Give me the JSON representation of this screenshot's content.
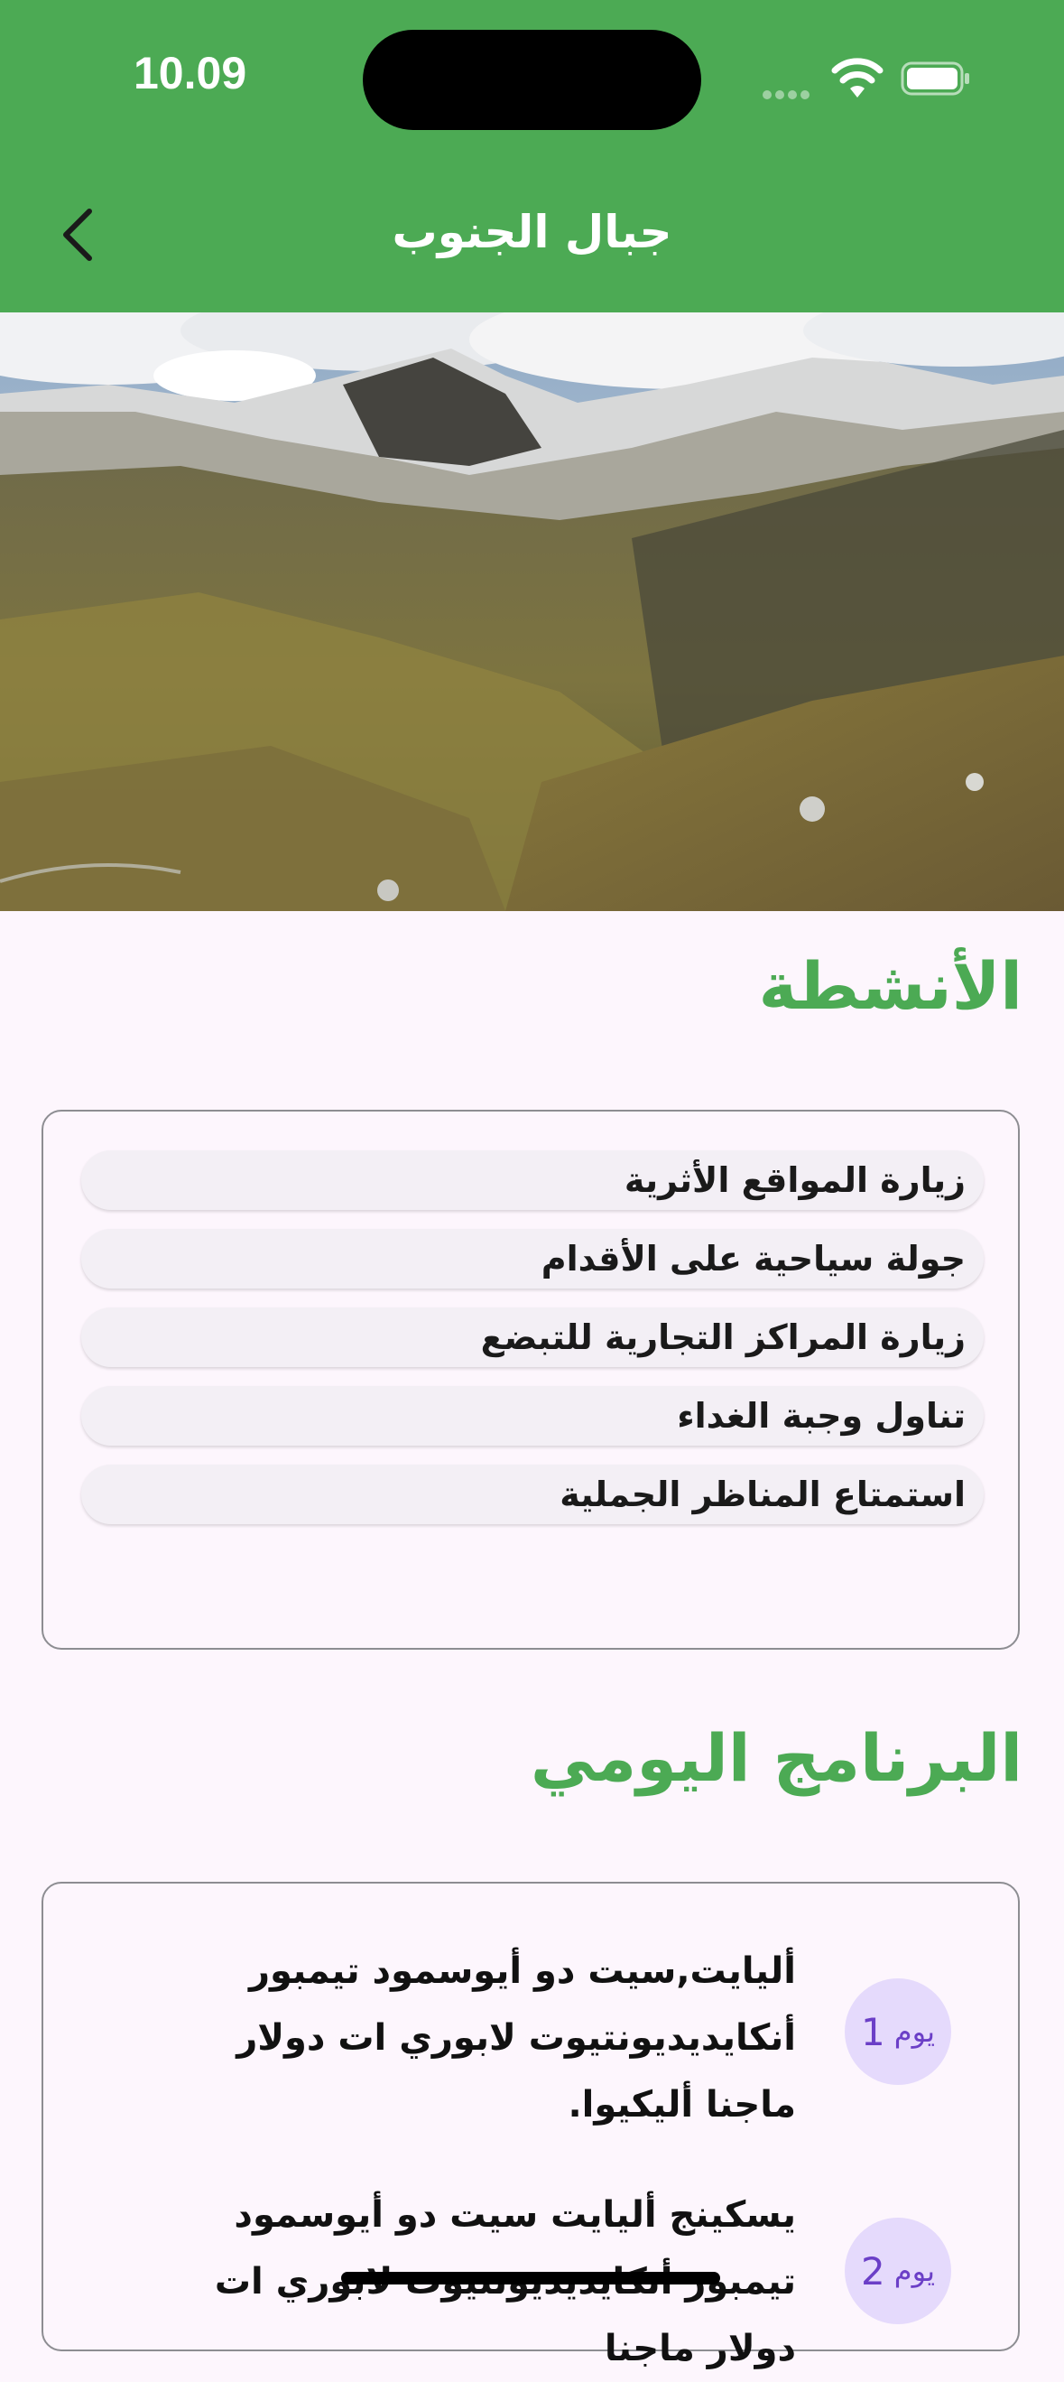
{
  "status_bar": {
    "time": "10.09"
  },
  "header": {
    "title": "جبال الجنوب"
  },
  "activities": {
    "heading": "الأنشطة",
    "items": [
      "زيارة المواقع الأثرية",
      "جولة سياحية على الأقدام",
      "زيارة المراكز التجارية للتبضع",
      "تناول وجبة الغداء",
      "استمتاع المناظر الجملية"
    ]
  },
  "program": {
    "heading": "البرنامج اليومي",
    "days": [
      {
        "label": "يوم",
        "number": "1",
        "text": "أليايت,سيت دو أيوسمود تيمبور أنكايديديونتيوت لابوري ات دولار ماجنا أليكيوا."
      },
      {
        "label": "يوم",
        "number": "2",
        "text": "يسكينج أليايت سيت دو أيوسمود تيمبور أنكايديديونتيوت لابوري ات دولار ماجنا"
      }
    ]
  },
  "colors": {
    "primary": "#4caa54",
    "background": "#fdf6fd",
    "badge_bg": "#e5dafc",
    "badge_text": "#6b3fc7"
  },
  "icons": {
    "back": "chevron-left-icon",
    "wifi": "wifi-icon",
    "battery": "battery-icon"
  }
}
